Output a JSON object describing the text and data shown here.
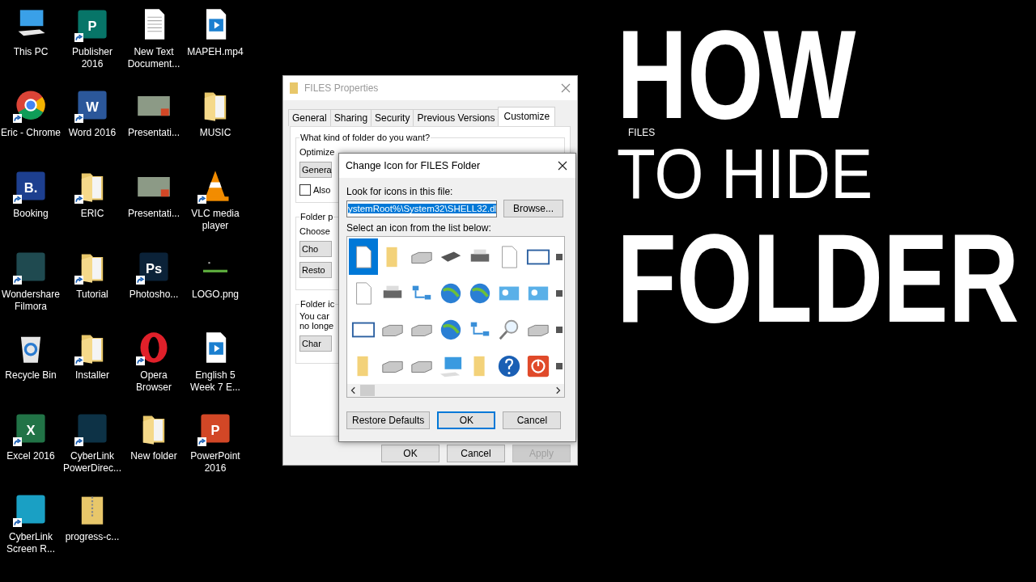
{
  "desktop_icons": [
    {
      "label": "This PC",
      "kind": "pc",
      "shortcut": false
    },
    {
      "label": "Publisher 2016",
      "kind": "tile",
      "color": "#077568",
      "glyph": "P",
      "shortcut": true
    },
    {
      "label": "New Text Document...",
      "kind": "document",
      "shortcut": false
    },
    {
      "label": "MAPEH.mp4",
      "kind": "video",
      "shortcut": false
    },
    {
      "label": "Eric - Chrome",
      "kind": "chrome",
      "shortcut": true
    },
    {
      "label": "Word 2016",
      "kind": "tile",
      "color": "#2b579a",
      "glyph": "W",
      "shortcut": true
    },
    {
      "label": "Presentati...",
      "kind": "slide",
      "shortcut": false
    },
    {
      "label": "MUSIC",
      "kind": "folder",
      "shortcut": false
    },
    {
      "label": "Booking",
      "kind": "tile",
      "color": "#1d3f8f",
      "glyph": "B.",
      "shortcut": true
    },
    {
      "label": "ERIC",
      "kind": "folder",
      "shortcut": true
    },
    {
      "label": "Presentati...",
      "kind": "slide",
      "shortcut": false
    },
    {
      "label": "VLC media player",
      "kind": "cone",
      "shortcut": true
    },
    {
      "label": "Wondershare Filmora",
      "kind": "tile",
      "color": "#1f4a50",
      "shortcut": true
    },
    {
      "label": "Tutorial",
      "kind": "folder",
      "shortcut": true
    },
    {
      "label": "Photosho...",
      "kind": "tile",
      "color": "#0b2238",
      "glyph": "Ps",
      "shortcut": true
    },
    {
      "label": "LOGO.png",
      "kind": "image",
      "shortcut": false
    },
    {
      "label": "Recycle Bin",
      "kind": "recycle",
      "shortcut": false
    },
    {
      "label": "Installer",
      "kind": "folder",
      "shortcut": true
    },
    {
      "label": "Opera Browser",
      "kind": "ring",
      "shortcut": true
    },
    {
      "label": "English 5 Week 7 E...",
      "kind": "video",
      "shortcut": false
    },
    {
      "label": "Excel 2016",
      "kind": "tile",
      "color": "#217346",
      "glyph": "X",
      "shortcut": true
    },
    {
      "label": "CyberLink PowerDirec...",
      "kind": "tile",
      "color": "#0d3246",
      "shortcut": true
    },
    {
      "label": "New folder",
      "kind": "folder",
      "shortcut": false
    },
    {
      "label": "PowerPoint 2016",
      "kind": "tile",
      "color": "#d24726",
      "glyph": "P",
      "shortcut": true
    },
    {
      "label": "CyberLink Screen R...",
      "kind": "tile",
      "color": "#1aa0c4",
      "shortcut": true
    },
    {
      "label": "progress-c...",
      "kind": "zip",
      "shortcut": false
    }
  ],
  "desktop_folder": {
    "label": "FILES"
  },
  "properties_window": {
    "title": "FILES Properties",
    "tabs": [
      {
        "label": "General",
        "selected": false
      },
      {
        "label": "Sharing",
        "selected": false
      },
      {
        "label": "Security",
        "selected": false
      },
      {
        "label": "Previous Versions",
        "selected": false
      },
      {
        "label": "Customize",
        "selected": true
      }
    ],
    "group_title": "What kind of folder do you want?",
    "optimize_label": "Optimize",
    "optimize_value": "Genera",
    "also_checkbox": {
      "label": "Also",
      "checked": false
    },
    "pictures_group": "Folder p",
    "choose_label": "Choose",
    "choose_button": "Cho",
    "restore_button": "Resto",
    "icons_group": "Folder ic",
    "icons_text": [
      "You car",
      "no longe"
    ],
    "change_button": "Char",
    "buttons": [
      {
        "label": "OK",
        "disabled": false
      },
      {
        "label": "Cancel",
        "disabled": false
      },
      {
        "label": "Apply",
        "disabled": true
      }
    ]
  },
  "change_icon_dialog": {
    "title": "Change Icon for FILES Folder",
    "file_label": "Look for icons in this file:",
    "file_value": "ystemRoot%\\System32\\SHELL32.dl",
    "file_value_selected": true,
    "browse_button": "Browse...",
    "list_label": "Select an icon from the list below:",
    "icons": [
      {
        "kind": "document",
        "selected": true
      },
      {
        "kind": "folder",
        "selected": false
      },
      {
        "kind": "drive",
        "selected": false
      },
      {
        "kind": "chip",
        "selected": false
      },
      {
        "kind": "printer",
        "selected": false
      },
      {
        "kind": "document",
        "selected": false
      },
      {
        "kind": "window",
        "selected": false
      },
      {
        "kind": "tile",
        "selected": false
      },
      {
        "kind": "document",
        "selected": false
      },
      {
        "kind": "printer",
        "selected": false
      },
      {
        "kind": "network",
        "selected": false
      },
      {
        "kind": "globe",
        "selected": false
      },
      {
        "kind": "globe",
        "selected": false
      },
      {
        "kind": "card",
        "selected": false
      },
      {
        "kind": "card",
        "selected": false
      },
      {
        "kind": "tile",
        "selected": false
      },
      {
        "kind": "window",
        "selected": false
      },
      {
        "kind": "drive",
        "selected": false
      },
      {
        "kind": "drive",
        "selected": false
      },
      {
        "kind": "globe",
        "selected": false
      },
      {
        "kind": "network",
        "selected": false
      },
      {
        "kind": "search",
        "selected": false
      },
      {
        "kind": "drive",
        "selected": false
      },
      {
        "kind": "tile",
        "selected": false
      },
      {
        "kind": "folder",
        "selected": false
      },
      {
        "kind": "drive",
        "selected": false
      },
      {
        "kind": "drive",
        "selected": false
      },
      {
        "kind": "monitor",
        "selected": false
      },
      {
        "kind": "folder",
        "selected": false
      },
      {
        "kind": "help",
        "selected": false
      },
      {
        "kind": "power",
        "selected": false
      },
      {
        "kind": "tile",
        "selected": false
      }
    ],
    "buttons": [
      {
        "label": "Restore Defaults",
        "default": false
      },
      {
        "label": "OK",
        "default": true
      },
      {
        "label": "Cancel",
        "default": false
      }
    ]
  },
  "headline": [
    {
      "text": "HOW",
      "kind": "bold"
    },
    {
      "text": "TO HIDE",
      "kind": "light"
    },
    {
      "text": "FOLDER",
      "kind": "bold"
    }
  ]
}
